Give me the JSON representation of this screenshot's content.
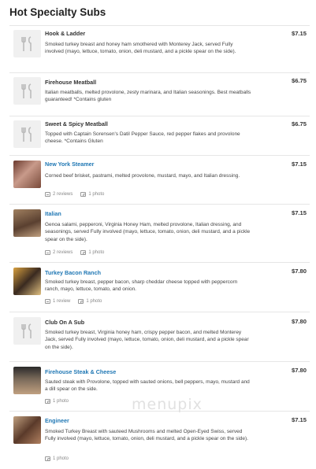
{
  "section": {
    "title": "Hot Specialty Subs"
  },
  "items": [
    {
      "name": "Hook & Ladder",
      "price": "$7.15",
      "description": "Smoked turkey breast and honey ham smothered with Monterey Jack, served Fully involved (mayo, lettuce, tomato, onion, deli mustard, and a pickle spear on the side).",
      "thumb": "utensils-icon"
    },
    {
      "name": "Firehouse Meatball",
      "price": "$6.75",
      "description": "Italian meatballs, melted provolone, zesty marinara, and Italian seasonings. Best meatballs guaranteed! *Contains gluten",
      "thumb": "utensils-icon"
    },
    {
      "name": "Sweet & Spicy Meatball",
      "price": "$6.75",
      "description": "Topped with Captain Sorensen's Datil Pepper Sauce, red pepper flakes and provolone cheese. *Contains Gluten",
      "thumb": "utensils-icon"
    },
    {
      "name": "New York Steamer",
      "price": "$7.15",
      "description": "Corned beef brisket, pastrami, melted provolone, mustard, mayo, and Italian dressing.",
      "reviews": "2 reviews",
      "photos": "1 photo",
      "thumb": "photo"
    },
    {
      "name": "Italian",
      "price": "$7.15",
      "description": "Genoa salami, pepperoni, Virginia Honey Ham, melted provolone, Italian dressing, and seasonings, served Fully involved (mayo, lettuce, tomato, onion, deli mustard, and a pickle spear on the side).",
      "reviews": "2 reviews",
      "photos": "1 photo",
      "thumb": "photo"
    },
    {
      "name": "Turkey Bacon Ranch",
      "price": "$7.80",
      "description": "Smoked turkey breast, pepper bacon, sharp cheddar cheese topped with peppercorn ranch, mayo, lettuce, tomato, and onion.",
      "reviews": "1 review",
      "photos": "1 photo",
      "thumb": "photo"
    },
    {
      "name": "Club On A Sub",
      "price": "$7.80",
      "description": "Smoked turkey breast, Virginia honey ham, crispy pepper bacon, and melted Monterey Jack, served Fully involved (mayo, lettuce, tomato, onion, deli mustard, and a pickle spear on the side).",
      "thumb": "utensils-icon"
    },
    {
      "name": "Firehouse Steak & Cheese",
      "price": "$7.80",
      "description": "Sauted steak with Provolone, topped with sauted onions, bell peppers, mayo, mustard and a dill spear on the side.",
      "photos": "1 photo",
      "thumb": "photo"
    },
    {
      "name": "Engineer",
      "price": "$7.15",
      "description": "Smoked Turkey Breast with sauteed Mushrooms and melted Open-Eyed Swiss, served Fully involved (mayo, lettuce, tomato, onion, deli mustard, and a pickle spear on the side).",
      "photos": "1 photo",
      "thumb": "photo"
    }
  ],
  "watermark": "menupix",
  "colors": {
    "link": "#1f77b4",
    "divider": "#e6e6e6"
  }
}
